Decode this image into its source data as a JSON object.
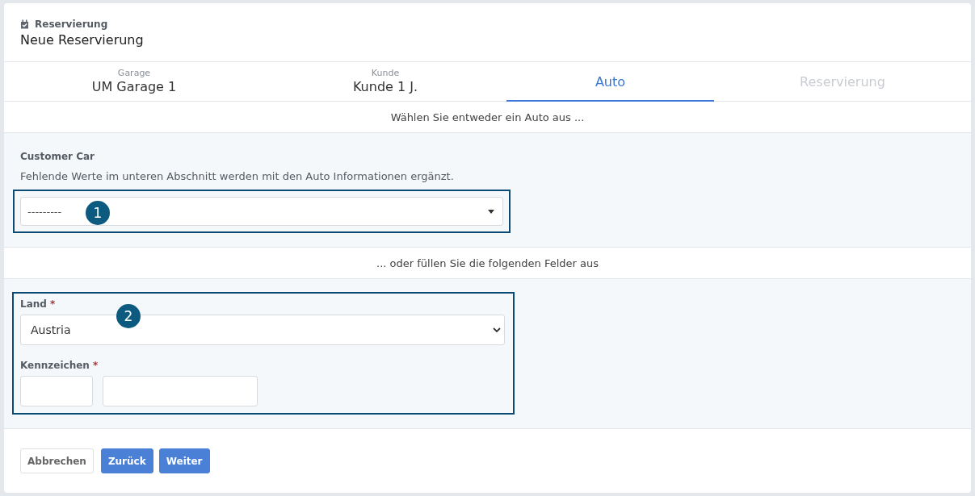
{
  "header": {
    "section": "Reservierung",
    "title": "Neue Reservierung"
  },
  "steps": [
    {
      "caption": "Garage",
      "label": "UM Garage 1",
      "selected": false,
      "disabled": false
    },
    {
      "caption": "Kunde",
      "label": "Kunde 1 J.",
      "selected": false,
      "disabled": false
    },
    {
      "label": "Auto",
      "selected": true,
      "disabled": false
    },
    {
      "label": "Reservierung",
      "selected": false,
      "disabled": true
    }
  ],
  "choose_hint": "Wählen Sie entweder ein Auto aus ...",
  "customer_car": {
    "heading": "Customer Car",
    "help": "Fehlende Werte im unteren Abschnitt werden mit den Auto Informationen ergänzt.",
    "select_value": "---------",
    "callout": "1"
  },
  "or_hint": "... oder füllen Sie die folgenden Felder aus",
  "vehicle_form": {
    "callout": "2",
    "fields": [
      {
        "kind": "select",
        "label": "Land",
        "required_mark": "*",
        "value": "Austria"
      },
      {
        "kind": "plate",
        "label": "Kennzeichen",
        "required_mark": "*"
      }
    ]
  },
  "buttons": [
    {
      "label": "Abbrechen",
      "kind": "secondary"
    },
    {
      "label": "Zurück",
      "kind": "primary"
    },
    {
      "label": "Weiter",
      "kind": "primary"
    }
  ]
}
